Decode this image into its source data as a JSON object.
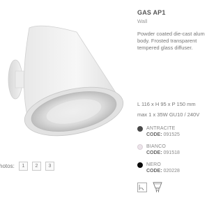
{
  "product": {
    "title": "GAS AP1",
    "category": "Wall",
    "description": "Powder coated die-cast alum body. Frosted transparent tempered glass diffuser.",
    "dimensions": "L 116 x H 95 x P 150 mm",
    "power": "max 1 x 35W GU10 / 240V"
  },
  "photos": {
    "label": "hotos:",
    "buttons": [
      "1",
      "2",
      "3"
    ]
  },
  "finishes": [
    {
      "name": "ANTRACITE",
      "code_label": "CODE:",
      "code": "091525",
      "color": "#4a4a4a"
    },
    {
      "name": "BIANCO",
      "code_label": "CODE:",
      "code": "091518",
      "color": "#ece4ea"
    },
    {
      "name": "NERO",
      "code_label": "CODE:",
      "code": "020228",
      "color": "#0a0a0a"
    }
  ],
  "icons": {
    "product": "wall-lamp-image",
    "spec_1": "wall-mount-icon",
    "spec_2": "gu10-bulb-icon"
  }
}
